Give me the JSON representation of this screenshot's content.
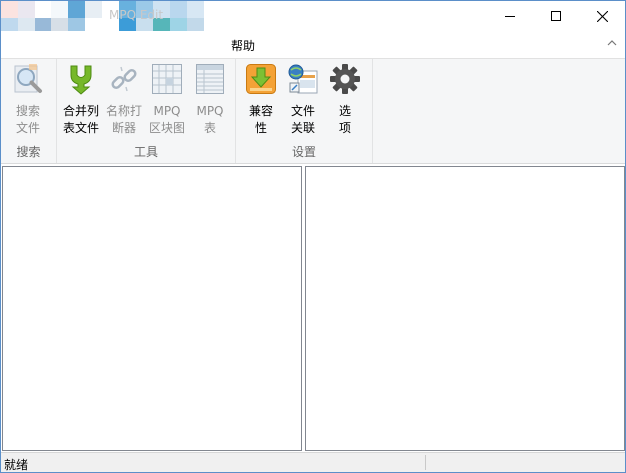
{
  "window": {
    "title": "MPQ Edit",
    "minimize_icon": "minimize-icon",
    "maximize_icon": "maximize-icon",
    "close_icon": "close-icon"
  },
  "tabs": {
    "help": "帮助"
  },
  "ribbon": {
    "groups": [
      {
        "label": "搜索",
        "buttons": [
          {
            "label": "搜索\n文件",
            "icon": "magnifier-icon",
            "enabled": false
          }
        ]
      },
      {
        "label": "工具",
        "buttons": [
          {
            "label": "合并列\n表文件",
            "icon": "merge-arrow-icon",
            "enabled": true
          },
          {
            "label": "名称打\n断器",
            "icon": "broken-chain-icon",
            "enabled": false
          },
          {
            "label": "MPQ\n区块图",
            "icon": "block-map-icon",
            "enabled": false
          },
          {
            "label": "MPQ\n表",
            "icon": "table-icon",
            "enabled": false
          }
        ]
      },
      {
        "label": "设置",
        "buttons": [
          {
            "label": "兼容\n性",
            "icon": "download-box-icon",
            "enabled": true
          },
          {
            "label": "文件\n关联",
            "icon": "file-association-icon",
            "enabled": true
          },
          {
            "label": "选\n项",
            "icon": "gear-icon",
            "enabled": true
          }
        ]
      }
    ]
  },
  "status": {
    "text": "就绪"
  },
  "colors": {
    "window_border": "#5b8fc9",
    "ribbon_bg": "#f5f6f7",
    "status_bg": "#f0f0f0"
  }
}
